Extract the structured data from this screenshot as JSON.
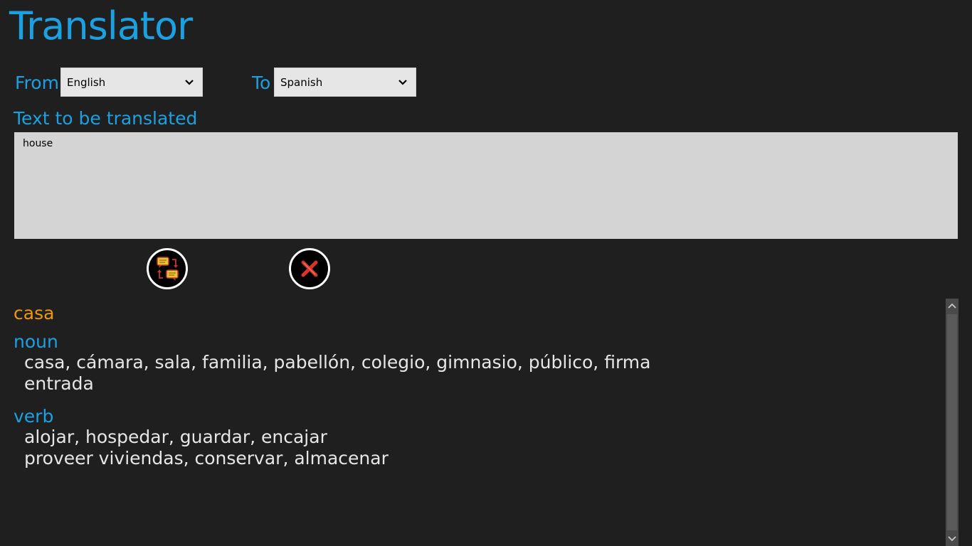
{
  "app": {
    "title": "Translator"
  },
  "languages": {
    "from_label": "From",
    "from_value": "English",
    "to_label": "To",
    "to_value": "Spanish"
  },
  "input": {
    "label": "Text to be translated",
    "value": "house"
  },
  "buttons": {
    "translate_icon": "translate-speech-bubbles-icon",
    "clear_icon": "clear-x-icon"
  },
  "results": {
    "word": "casa",
    "noun_label": "noun",
    "noun_line1": "casa,  cámara,  sala,  familia,  pabellón,  colegio,  gimnasio,  público,  firma",
    "noun_line2": "entrada",
    "verb_label": "verb",
    "verb_line1": "alojar,  hospedar,  guardar,  encajar",
    "verb_line2": "proveer viviendas,  conservar,  almacenar"
  },
  "colors": {
    "accent": "#1ba1e2",
    "highlight": "#f09609",
    "background": "#1f1f1f"
  }
}
